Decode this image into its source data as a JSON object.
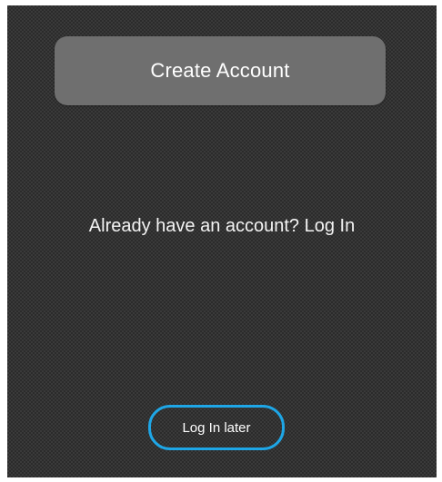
{
  "onboarding": {
    "create_account_label": "Create Account",
    "login_prompt": "Already have an account? Log In",
    "log_in_later_label": "Log In later"
  },
  "colors": {
    "button_fill": "#6f6f6f",
    "focus_ring": "#1ea6e6",
    "text": "#ffffff"
  }
}
